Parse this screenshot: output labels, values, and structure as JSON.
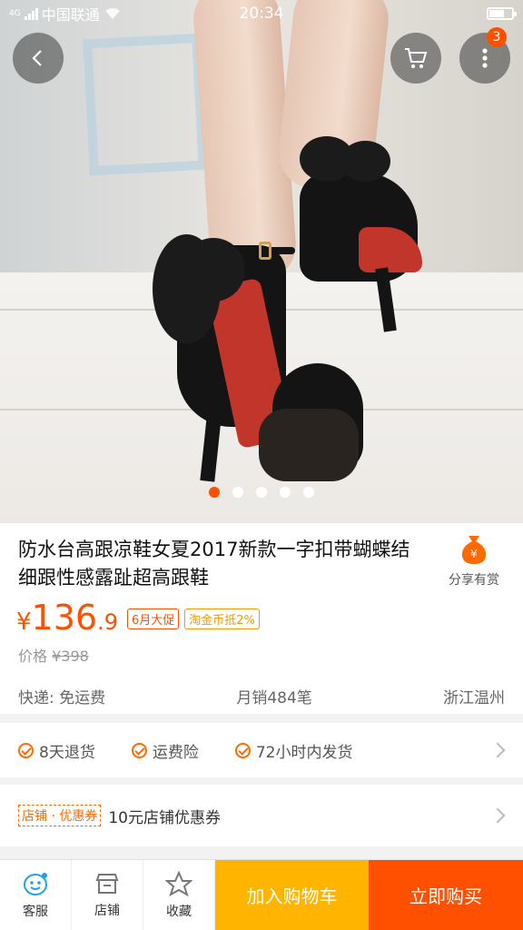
{
  "status_bar": {
    "network": "4G",
    "carrier": "中国联通",
    "time": "20:34"
  },
  "header": {
    "cart_badge": "3"
  },
  "carousel": {
    "total": 5,
    "active": 1
  },
  "product": {
    "title": "防水台高跟凉鞋女夏2017新款一字扣带蝴蝶结细跟性感露趾超高跟鞋",
    "price_currency": "¥",
    "price_int": "136",
    "price_dec": ".9",
    "promo_tag": "6月大促",
    "coin_tag": "淘金币抵2%",
    "orig_label": "价格",
    "orig_price": "¥398",
    "shipping": "快递: 免运费",
    "monthly_sales": "月销484笔",
    "location": "浙江温州",
    "share_label": "分享有赏"
  },
  "services": [
    "8天退货",
    "运费险",
    "72小时内发货"
  ],
  "coupon": {
    "tag": "店铺 · 优惠券",
    "text": "10元店铺优惠券"
  },
  "bottom_bar": {
    "service": "客服",
    "shop": "店铺",
    "favorite": "收藏",
    "add_to_cart": "加入购物车",
    "buy_now": "立即购买"
  },
  "colors": {
    "accent": "#ff5000",
    "cart_button": "#ffb400"
  }
}
